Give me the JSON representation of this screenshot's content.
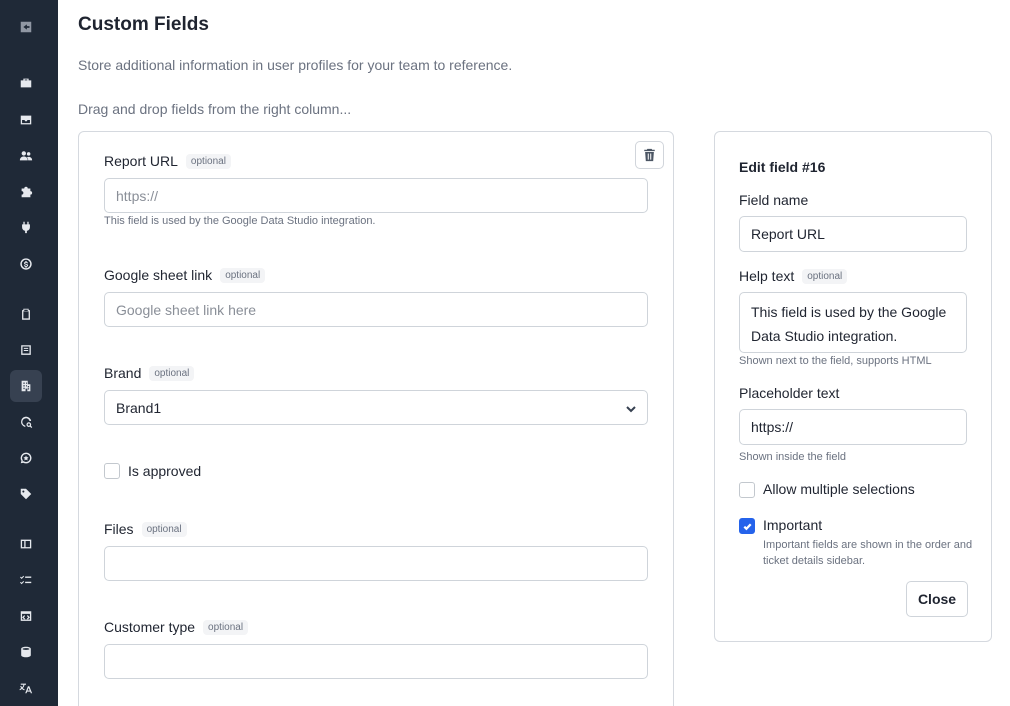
{
  "page": {
    "title": "Custom Fields",
    "subtitle": "Store additional information in user profiles for your team to reference.",
    "hint": "Drag and drop fields from the right column..."
  },
  "sidebar": {
    "items": [
      {
        "icon": "collapse-sidebar-icon"
      },
      {
        "icon": "briefcase-icon"
      },
      {
        "icon": "inbox-icon"
      },
      {
        "icon": "users-icon"
      },
      {
        "icon": "puzzle-icon"
      },
      {
        "icon": "plug-icon"
      },
      {
        "icon": "billing-icon"
      },
      {
        "icon": "clipboard-icon"
      },
      {
        "icon": "form-icon"
      },
      {
        "icon": "building-icon",
        "active": true
      },
      {
        "icon": "chat-search-icon"
      },
      {
        "icon": "chat-star-icon"
      },
      {
        "icon": "tag-icon"
      },
      {
        "icon": "sidebar-layout-icon"
      },
      {
        "icon": "checklist-icon"
      },
      {
        "icon": "window-code-icon"
      },
      {
        "icon": "database-icon"
      },
      {
        "icon": "translate-icon"
      }
    ]
  },
  "form": {
    "optional_badge": "optional",
    "report_url": {
      "label": "Report URL",
      "placeholder": "https://",
      "help": "This field is used by the Google Data Studio integration."
    },
    "google_sheet": {
      "label": "Google sheet link",
      "placeholder": "Google sheet link here"
    },
    "brand": {
      "label": "Brand",
      "value": "Brand1"
    },
    "is_approved": {
      "label": "Is approved",
      "checked": false
    },
    "files": {
      "label": "Files",
      "value": ""
    },
    "customer_type": {
      "label": "Customer type",
      "value": ""
    }
  },
  "edit_panel": {
    "title": "Edit field #16",
    "field_name_label": "Field name",
    "field_name_value": "Report URL",
    "help_text_label": "Help text",
    "help_text_badge": "optional",
    "help_text_line1": "This field is used by the Google",
    "help_text_line2": "Data Studio integration.",
    "help_text_hint": "Shown next to the field, supports HTML",
    "placeholder_label": "Placeholder text",
    "placeholder_value": "https://",
    "placeholder_hint": "Shown inside the field",
    "allow_multiple_label": "Allow multiple selections",
    "allow_multiple_checked": false,
    "important_label": "Important",
    "important_checked": true,
    "important_hint": "Important fields are shown in the order and ticket details sidebar.",
    "close_label": "Close"
  },
  "colors": {
    "sidebar_bg": "#1f2937",
    "accent": "#2563eb"
  }
}
